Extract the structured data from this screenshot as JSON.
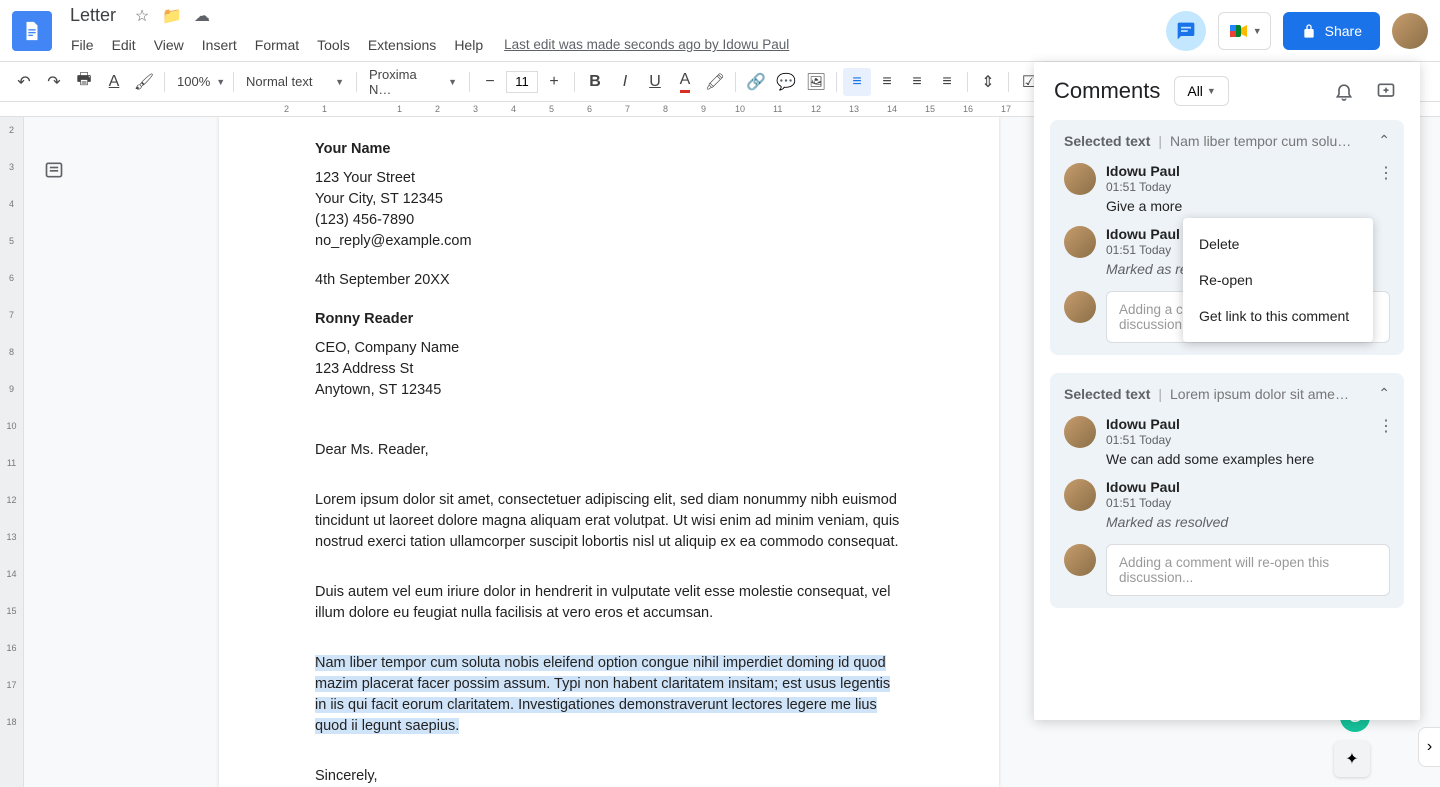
{
  "header": {
    "doc_title": "Letter",
    "menus": [
      "File",
      "Edit",
      "View",
      "Insert",
      "Format",
      "Tools",
      "Extensions",
      "Help"
    ],
    "last_edit": "Last edit was made seconds ago by Idowu Paul",
    "share_label": "Share"
  },
  "toolbar": {
    "zoom": "100%",
    "style": "Normal text",
    "font": "Proxima N…",
    "fontsize": "11"
  },
  "ruler": [
    "2",
    "1",
    "",
    "1",
    "2",
    "3",
    "4",
    "5",
    "6",
    "7",
    "8",
    "9",
    "10",
    "11",
    "12",
    "13",
    "14",
    "15",
    "16",
    "17"
  ],
  "vruler": [
    "",
    "2",
    "3",
    "4",
    "5",
    "6",
    "7",
    "8",
    "9",
    "10",
    "11",
    "12",
    "13",
    "14",
    "15",
    "16",
    "17",
    "18"
  ],
  "doc": {
    "name_header": "Your Name",
    "addr1": "123 Your Street",
    "addr2": "Your City, ST 12345",
    "phone": "(123) 456-7890",
    "email": "no_reply@example.com",
    "date": "4th September 20XX",
    "recipient_name": "Ronny Reader",
    "recipient_title": "CEO, Company Name",
    "recipient_addr1": "123 Address St",
    "recipient_addr2": "Anytown, ST 12345",
    "salutation": "Dear Ms. Reader,",
    "para1": "Lorem ipsum dolor sit amet, consectetuer adipiscing elit, sed diam nonummy nibh euismod tincidunt ut laoreet dolore magna aliquam erat volutpat. Ut wisi enim ad minim veniam, quis nostrud exerci tation ullamcorper suscipit lobortis nisl ut aliquip ex ea commodo consequat.",
    "para2": "Duis autem vel eum iriure dolor in hendrerit in vulputate velit esse molestie consequat, vel illum dolore eu feugiat nulla facilisis at vero eros et accumsan.",
    "para3": "Nam liber tempor cum soluta nobis eleifend option congue nihil imperdiet doming id quod mazim placerat facer possim assum. Typi non habent claritatem insitam; est usus legentis in iis qui facit eorum claritatem. Investigationes demonstraverunt lectores legere me lius quod ii legunt saepius.",
    "closing": "Sincerely,"
  },
  "comments_panel": {
    "title": "Comments",
    "filter": "All",
    "thread_label": "Selected text",
    "ctx_menu": [
      "Delete",
      "Re-open",
      "Get link to this comment"
    ],
    "threads": [
      {
        "excerpt": "Nam liber tempor cum solu…",
        "entries": [
          {
            "author": "Idowu Paul",
            "time": "01:51 Today",
            "text": "Give a more"
          },
          {
            "author": "Idowu Paul",
            "time": "01:51 Today",
            "resolved": "Marked as re"
          }
        ],
        "reply_placeholder": "Adding a comment will re-open this discussion..."
      },
      {
        "excerpt": "Lorem ipsum dolor sit ame…",
        "entries": [
          {
            "author": "Idowu Paul",
            "time": "01:51 Today",
            "text": "We can add some examples here"
          },
          {
            "author": "Idowu Paul",
            "time": "01:51 Today",
            "resolved": "Marked as resolved"
          }
        ],
        "reply_placeholder": "Adding a comment will re-open this discussion..."
      }
    ]
  }
}
